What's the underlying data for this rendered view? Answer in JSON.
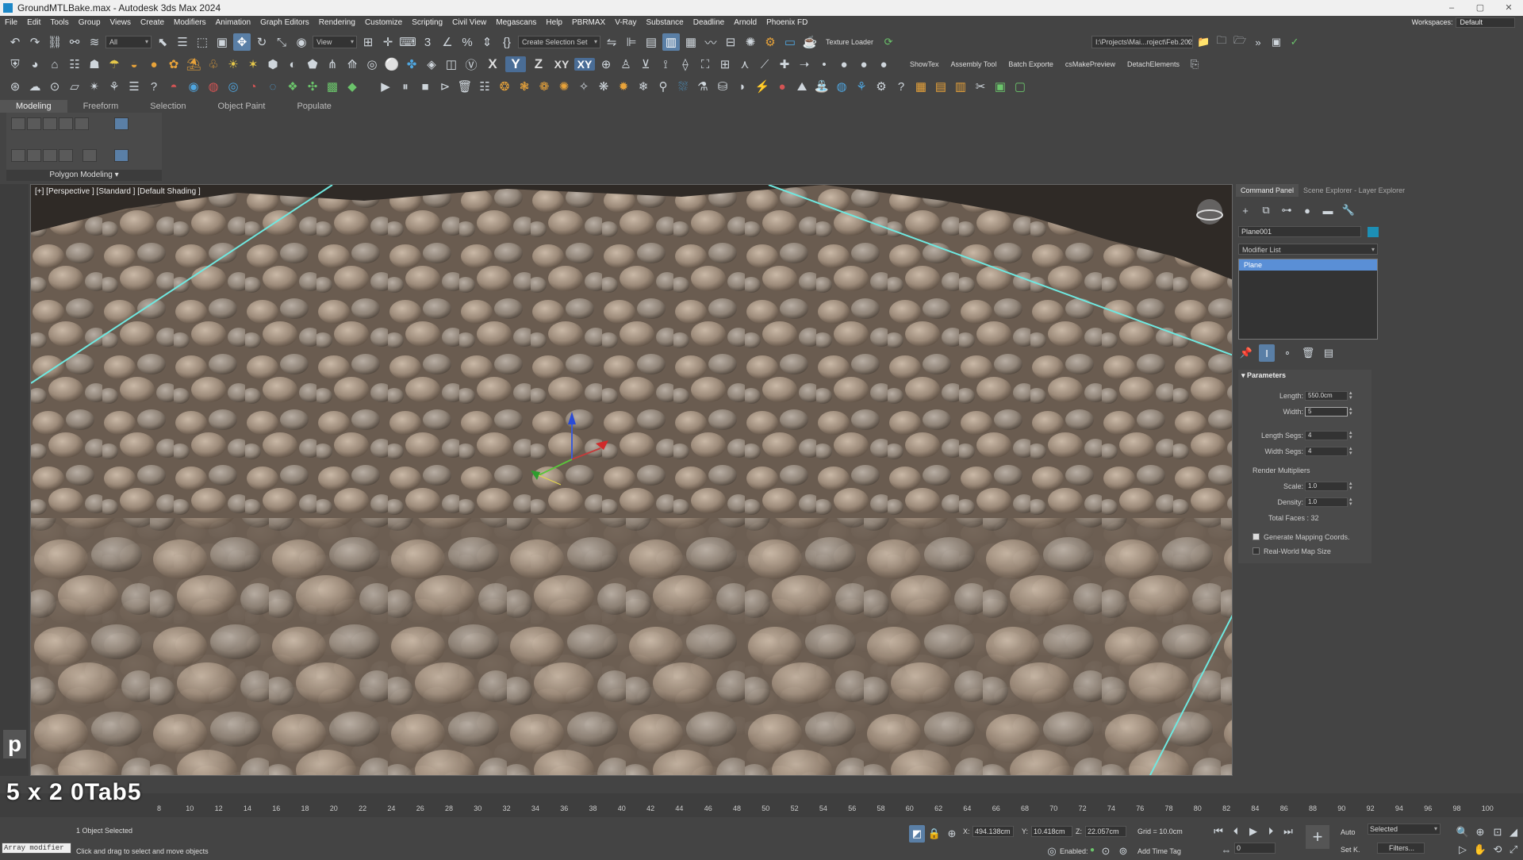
{
  "window": {
    "title": "GroundMTLBake.max - Autodesk 3ds Max 2024",
    "min": "–",
    "max": "▢",
    "close": "✕"
  },
  "menu": [
    "File",
    "Edit",
    "Tools",
    "Group",
    "Views",
    "Create",
    "Modifiers",
    "Animation",
    "Graph Editors",
    "Rendering",
    "Customize",
    "Scripting",
    "Civil View",
    "Megascans",
    "Help",
    "PBRMAX",
    "V-Ray",
    "Substance",
    "Deadline",
    "Arnold",
    "Phoenix FD"
  ],
  "workspaces": {
    "label": "Workspaces:",
    "value": "Default"
  },
  "toolbar1": {
    "filter_dropdown": "All",
    "view_dropdown": "View",
    "selection_set": "Create Selection Set",
    "texture_loader": "Texture Loader",
    "project_path": "I:\\Projects\\Mai...roject\\Feb.202"
  },
  "toolbar2": {
    "axis_x": "X",
    "axis_y": "Y",
    "axis_z": "Z",
    "axis_xy": "XY",
    "axis_xy2": "XY",
    "show_tex": "ShowTex",
    "assembly_tool": "Assembly Tool",
    "batch_exporter": "Batch Exporte",
    "cs_make_preview": "csMakePreview",
    "detach_elements": "DetachElements"
  },
  "ribbon": {
    "tabs": [
      "Modeling",
      "Freeform",
      "Selection",
      "Object Paint",
      "Populate"
    ],
    "panel_label": "Polygon Modeling ▾"
  },
  "viewport": {
    "label": "[+] [Perspective ] [Standard ] [Default Shading ]"
  },
  "command_panel": {
    "tabs": [
      "Command Panel",
      "Scene Explorer - Layer Explorer"
    ],
    "object_name": "Plane001",
    "object_color": "#1d8fb5",
    "modifier_list": "Modifier List",
    "stack_item": "Plane",
    "parameters": {
      "header": "Parameters",
      "length_label": "Length:",
      "length_value": "550.0cm",
      "width_label": "Width:",
      "width_value": "5",
      "length_segs_label": "Length Segs:",
      "length_segs_value": "4",
      "width_segs_label": "Width Segs:",
      "width_segs_value": "4",
      "render_mult_label": "Render Multipliers",
      "scale_label": "Scale:",
      "scale_value": "1.0",
      "density_label": "Density:",
      "density_value": "1.0",
      "total_faces": "Total Faces : 32",
      "gen_mapping": "Generate Mapping Coords.",
      "real_world": "Real-World Map Size"
    }
  },
  "timeline": {
    "ticks": [
      "8",
      "10",
      "12",
      "14",
      "16",
      "18",
      "20",
      "22",
      "24",
      "26",
      "28",
      "30",
      "32",
      "34",
      "36",
      "38",
      "40",
      "42",
      "44",
      "46",
      "48",
      "50",
      "52",
      "54",
      "56",
      "58",
      "60",
      "62",
      "64",
      "66",
      "68",
      "70",
      "72",
      "74",
      "76",
      "78",
      "80",
      "82",
      "84",
      "86",
      "88",
      "90",
      "92",
      "94",
      "96",
      "98",
      "100"
    ]
  },
  "overlay": {
    "keycast": "5 x 2 0Tab5",
    "p_key": "p"
  },
  "status": {
    "maxscript": "Array modifier",
    "selected": "1 Object Selected",
    "prompt": "Click and drag to select and move objects",
    "x": "494.138cm",
    "y": "10.418cm",
    "z": "22.057cm",
    "grid": "Grid = 10.0cm",
    "enabled": "Enabled:",
    "add_time_tag": "Add Time Tag",
    "auto": "Auto",
    "set_k": "Set K.",
    "selected_dd": "Selected",
    "filters": "Filters...",
    "frame": "0"
  }
}
